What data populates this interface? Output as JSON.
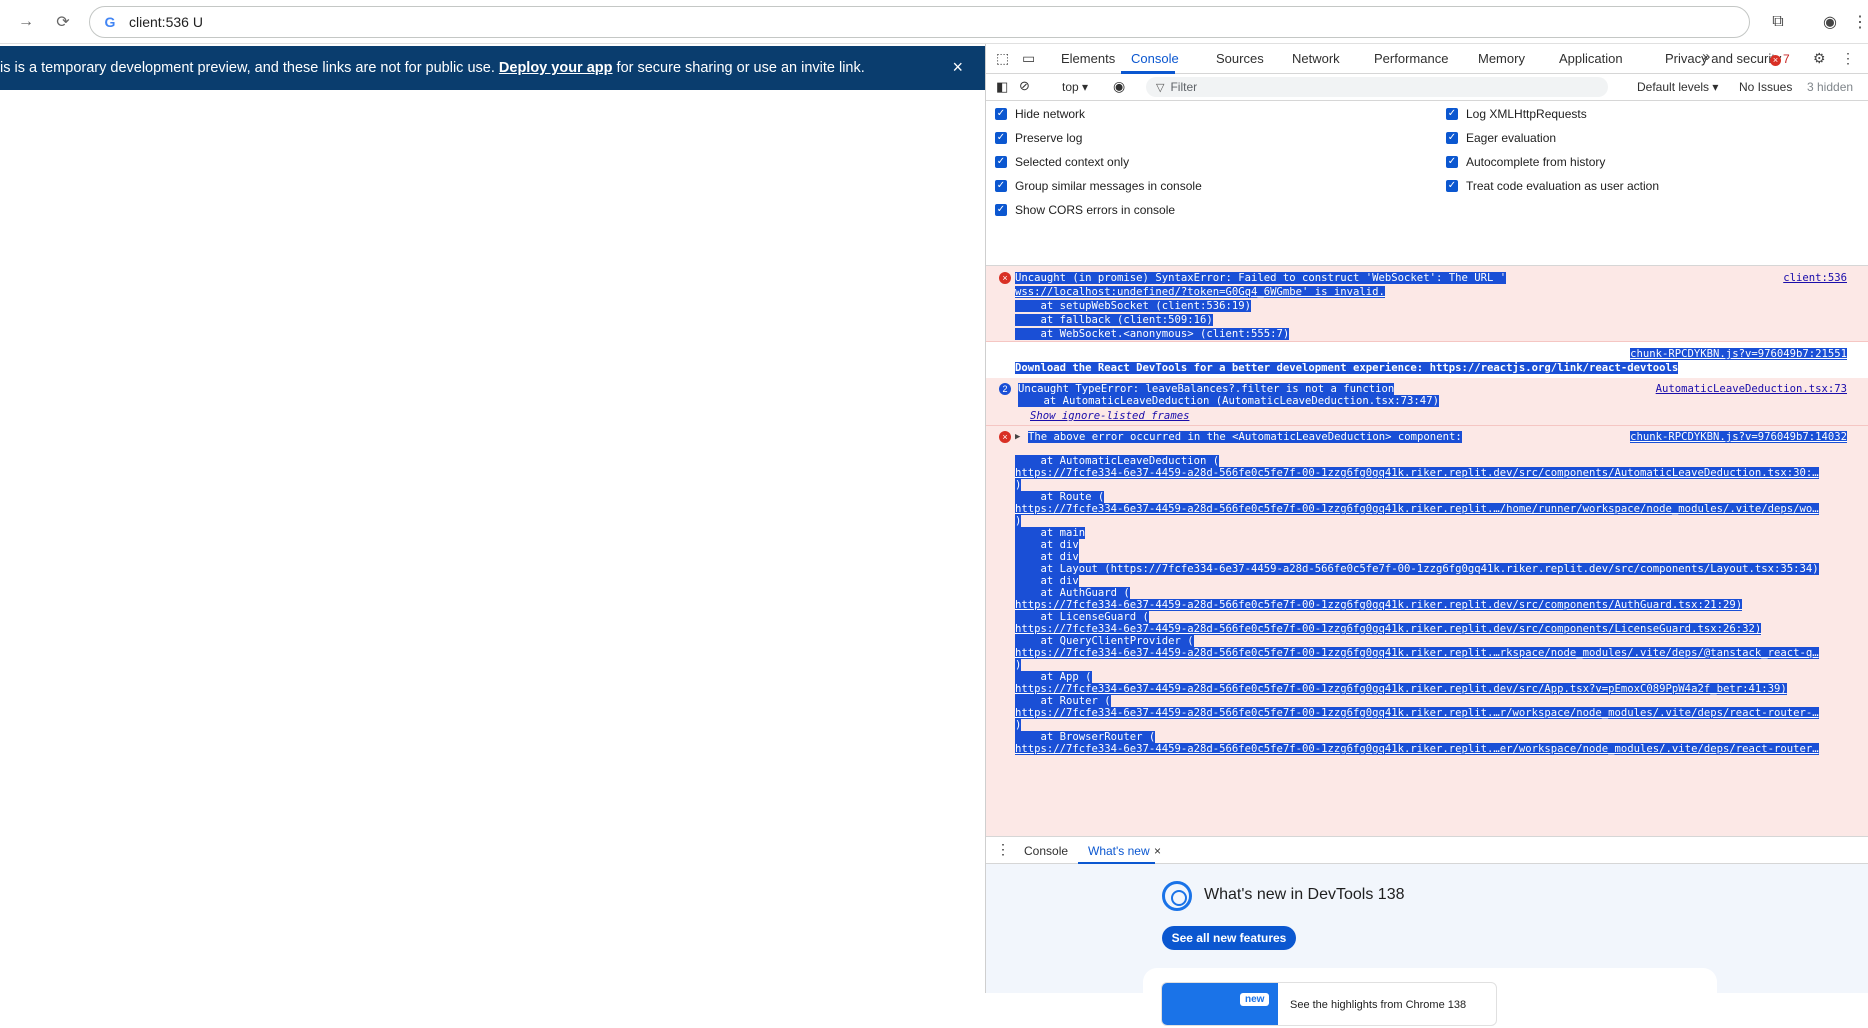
{
  "browser": {
    "address": "client:536 U"
  },
  "banner": {
    "text_before": "is is a temporary development preview, and these links are not for public use. ",
    "link": "Deploy your app",
    "text_after": " for secure sharing or use an invite link.",
    "close": "×"
  },
  "devtools": {
    "tabs": [
      "Elements",
      "Console",
      "Sources",
      "Network",
      "Performance",
      "Memory",
      "Application",
      "Privacy and security"
    ],
    "more": "»",
    "error_count": "7",
    "toolbar": {
      "context": "top",
      "filter_placeholder": "Filter",
      "levels": "Default levels",
      "issues": "No Issues",
      "hidden": "3 hidden"
    },
    "settings_left": [
      "Hide network",
      "Preserve log",
      "Selected context only",
      "Group similar messages in console",
      "Show CORS errors in console"
    ],
    "settings_right": [
      "Log XMLHttpRequests",
      "Eager evaluation",
      "Autocomplete from history",
      "Treat code evaluation as user action"
    ],
    "console": {
      "m1": {
        "lines": [
          "Uncaught (in promise) SyntaxError: Failed to construct 'WebSocket': The URL '",
          "wss://localhost:undefined/?token=G0Gq4_6WGmbe' is invalid.",
          "    at setupWebSocket (client:536:19)",
          "    at fallback (client:509:16)",
          "    at WebSocket.<anonymous> (client:555:7)"
        ],
        "source": "client:536"
      },
      "m2": {
        "source": "chunk-RPCDYKBN.js?v=976049b7:21551",
        "line": "Download the React DevTools for a better development experience: https://reactjs.org/link/react-devtools"
      },
      "m3": {
        "count": "2",
        "lines": [
          "Uncaught TypeError: leaveBalances?.filter is not a function",
          "    at AutomaticLeaveDeduction (AutomaticLeaveDeduction.tsx:73:47)"
        ],
        "ignore_link": "Show ignore-listed frames",
        "source": "AutomaticLeaveDeduction.tsx:73"
      },
      "m4": {
        "header": "The above error occurred in the <AutomaticLeaveDeduction> component:",
        "source": "chunk-RPCDYKBN.js?v=976049b7:14032",
        "lines": [
          "    at AutomaticLeaveDeduction (",
          "https://7fcfe334-6e37-4459-a28d-566fe0c5fe7f-00-1zzg6fg0gq41k.riker.replit.dev/src/components/AutomaticLeaveDeduction.tsx:30:…",
          ")",
          "    at Route (",
          "https://7fcfe334-6e37-4459-a28d-566fe0c5fe7f-00-1zzg6fg0gq41k.riker.replit.…/home/runner/workspace/node_modules/.vite/deps/wo…",
          ")",
          "    at main",
          "    at div",
          "    at div",
          "    at Layout (https://7fcfe334-6e37-4459-a28d-566fe0c5fe7f-00-1zzg6fg0gq41k.riker.replit.dev/src/components/Layout.tsx:35:34)",
          "    at div",
          "    at AuthGuard (",
          "https://7fcfe334-6e37-4459-a28d-566fe0c5fe7f-00-1zzg6fg0gq41k.riker.replit.dev/src/components/AuthGuard.tsx:21:29)",
          "    at LicenseGuard (",
          "https://7fcfe334-6e37-4459-a28d-566fe0c5fe7f-00-1zzg6fg0gq41k.riker.replit.dev/src/components/LicenseGuard.tsx:26:32)",
          "    at QueryClientProvider (",
          "https://7fcfe334-6e37-4459-a28d-566fe0c5fe7f-00-1zzg6fg0gq41k.riker.replit.…rkspace/node_modules/.vite/deps/@tanstack_react-q…",
          ")",
          "    at App (",
          "https://7fcfe334-6e37-4459-a28d-566fe0c5fe7f-00-1zzg6fg0gq41k.riker.replit.dev/src/App.tsx?v=pEmoxC089PpW4a2f_betr:41:39)",
          "    at Router (",
          "https://7fcfe334-6e37-4459-a28d-566fe0c5fe7f-00-1zzg6fg0gq41k.riker.replit.…r/workspace/node_modules/.vite/deps/react-router-…",
          ")",
          "    at BrowserRouter (",
          "https://7fcfe334-6e37-4459-a28d-566fe0c5fe7f-00-1zzg6fg0gq41k.riker.replit.…er/workspace/node_modules/.vite/deps/react-router…"
        ]
      }
    },
    "drawer": {
      "tab_console": "Console",
      "tab_whatsnew": "What's new",
      "close": "×"
    },
    "whatsnew": {
      "title": "What's new in DevTools 138",
      "button": "See all new features",
      "badge": "new",
      "card_text": "See the highlights from Chrome 138"
    }
  }
}
